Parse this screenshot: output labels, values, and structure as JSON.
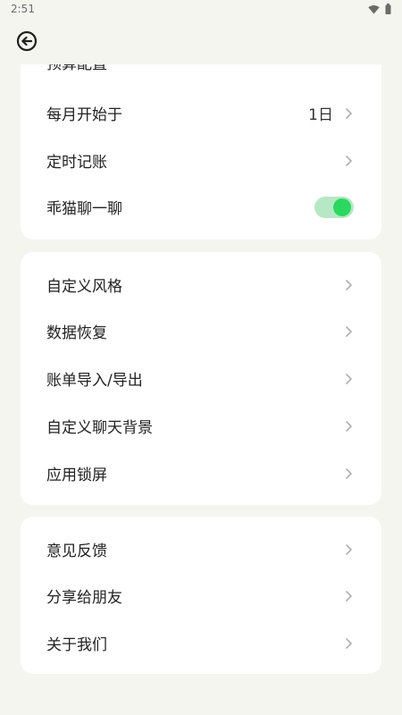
{
  "status_bar": {
    "time": "2:51"
  },
  "header": {
    "back_icon": "back-arrow-circle-icon"
  },
  "settings": {
    "group1": [
      {
        "label": "预算配置",
        "value": ""
      },
      {
        "label": "每月开始于",
        "value": "1日"
      },
      {
        "label": "定时记账",
        "value": ""
      },
      {
        "label": "乖猫聊一聊",
        "toggle": true
      }
    ],
    "group2": [
      {
        "label": "自定义风格"
      },
      {
        "label": "数据恢复"
      },
      {
        "label": "账单导入/导出"
      },
      {
        "label": "自定义聊天背景"
      },
      {
        "label": "应用锁屏"
      }
    ],
    "group3": [
      {
        "label": "意见反馈"
      },
      {
        "label": "分享给朋友"
      },
      {
        "label": "关于我们"
      }
    ]
  },
  "colors": {
    "background": "#f4f5ee",
    "card": "#ffffff",
    "toggle_on_track": "#b7e8c6",
    "toggle_on_knob": "#2bd95f",
    "chevron": "#b0b0b0"
  }
}
